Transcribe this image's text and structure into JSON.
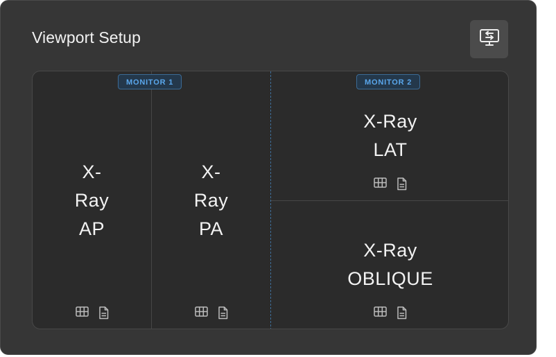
{
  "dialog": {
    "title": "Viewport Setup",
    "swap_icon": "monitor-swap-icon"
  },
  "monitors": [
    {
      "badge": "MONITOR 1"
    },
    {
      "badge": "MONITOR 2"
    }
  ],
  "viewports": [
    {
      "label_lines": [
        "X-",
        "Ray",
        "AP"
      ],
      "icons": [
        "grid-icon",
        "document-icon"
      ]
    },
    {
      "label_lines": [
        "X-",
        "Ray",
        "PA"
      ],
      "icons": [
        "grid-icon",
        "document-icon"
      ]
    },
    {
      "label_lines": [
        "X-Ray",
        "LAT"
      ],
      "icons": [
        "grid-icon",
        "document-icon"
      ]
    },
    {
      "label_lines": [
        "X-Ray",
        "OBLIQUE"
      ],
      "icons": [
        "grid-icon",
        "document-icon"
      ]
    }
  ],
  "colors": {
    "panel_bg": "#363636",
    "grid_bg": "#2b2b2b",
    "accent": "#5aa7ec",
    "monitor_split": "#3f6f9b"
  }
}
